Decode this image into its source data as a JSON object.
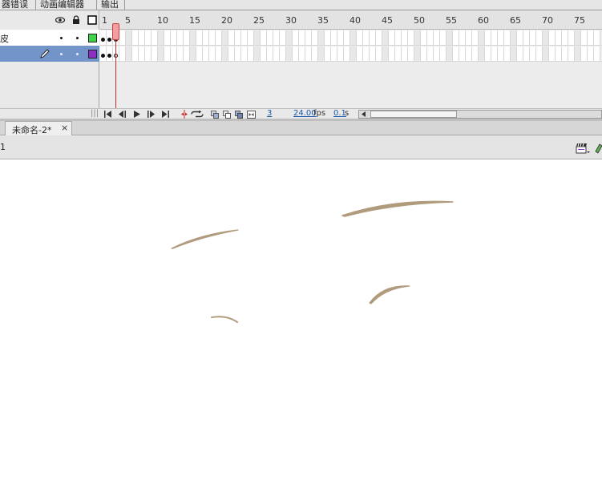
{
  "panel_tabs": [
    "器错误",
    "动画编辑器",
    "输出"
  ],
  "timeline": {
    "ruler_ticks": [
      "1",
      "5",
      "10",
      "15",
      "20",
      "25",
      "30",
      "35",
      "40",
      "45",
      "50",
      "55",
      "60",
      "65",
      "70",
      "75"
    ],
    "header_icons": [
      "eye-icon",
      "lock-icon",
      "outline-icon"
    ],
    "layers": [
      {
        "name": "皮",
        "color": "#3fd24b",
        "selected": false
      },
      {
        "name": "",
        "color": "#8e2fc4",
        "selected": true
      }
    ],
    "status": {
      "current_frame": "3",
      "frame_rate": "24.00",
      "frame_rate_unit": "fps",
      "elapsed_time": "0.1",
      "elapsed_unit": "s"
    },
    "controls": [
      "first-frame-icon",
      "step-back-icon",
      "play-icon",
      "step-forward-icon",
      "last-frame-icon",
      "center-frame-icon",
      "loop-icon",
      "onion-skin-icon",
      "onion-outline-icon",
      "edit-multiple-icon",
      "onion-markers-icon"
    ]
  },
  "document": {
    "tab_title": "未命名-2*",
    "close_glyph": "×",
    "scene_label": "1"
  },
  "stage": {
    "stroke_color": "#b09b7d",
    "background": "#ffffff"
  }
}
